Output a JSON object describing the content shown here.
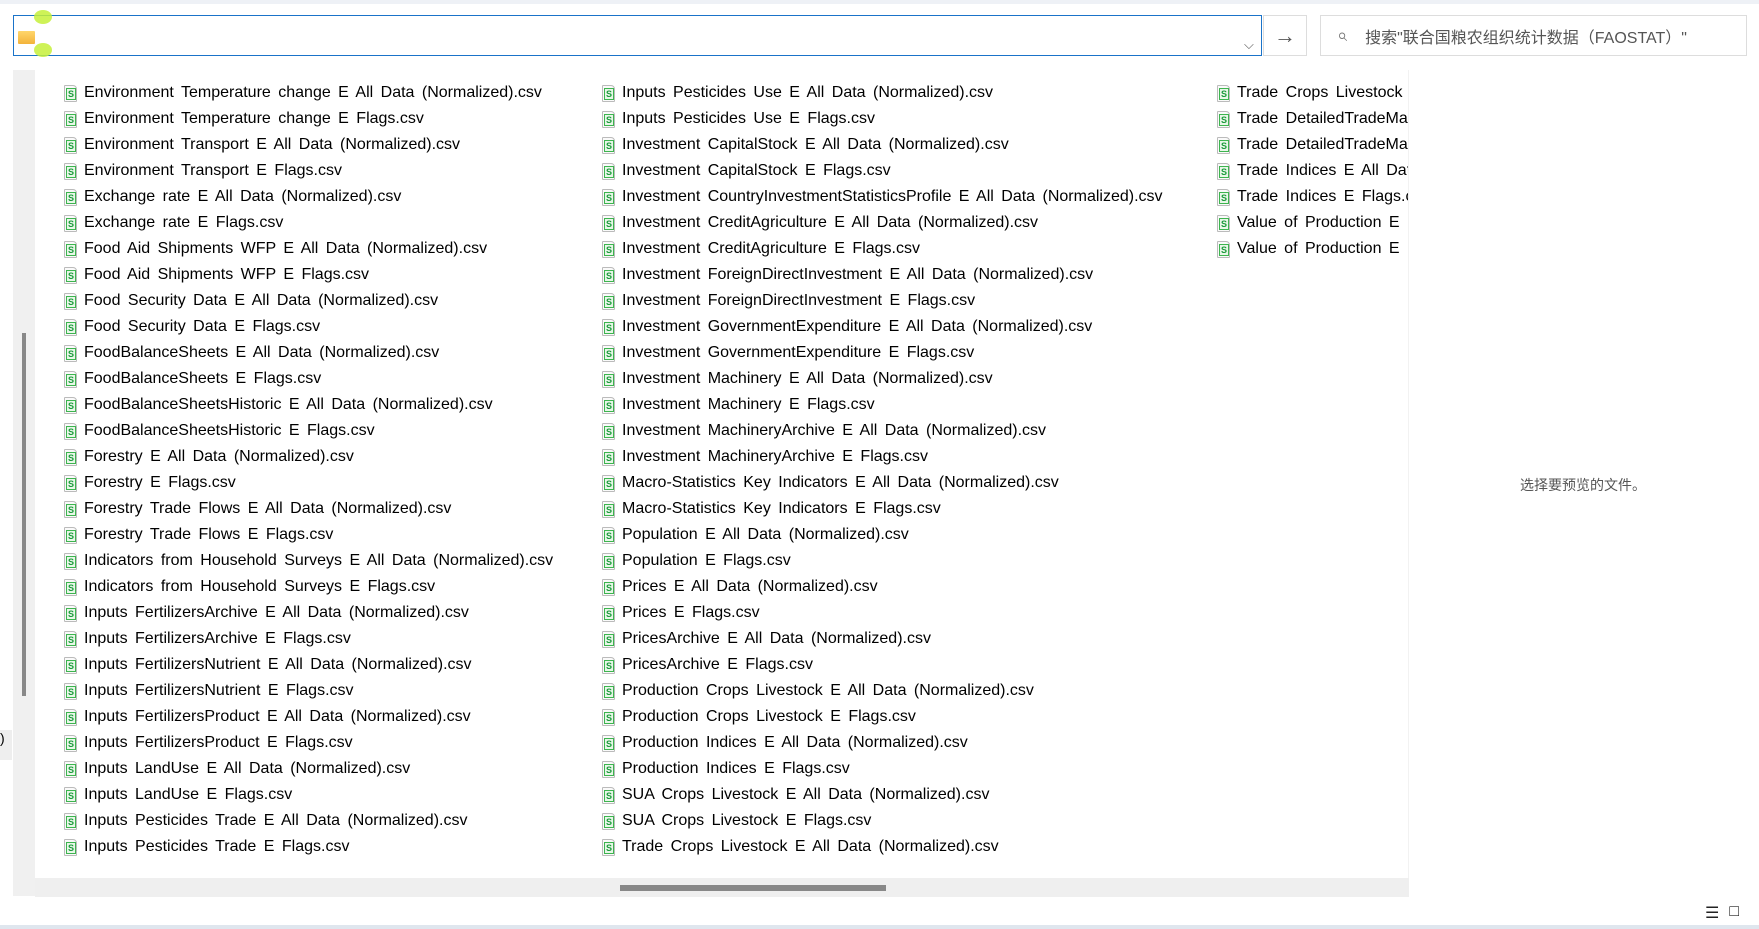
{
  "address_bar": {
    "value": ""
  },
  "search": {
    "placeholder": "搜索\"联合国粮农组织统计数据（FAOSTAT）\""
  },
  "preview_message": "选择要预览的文件。",
  "columns": [
    [
      "Environment Temperature change E All Data (Normalized).csv",
      "Environment Temperature change E Flags.csv",
      "Environment Transport E All Data (Normalized).csv",
      "Environment Transport E Flags.csv",
      "Exchange rate E All Data (Normalized).csv",
      "Exchange rate E Flags.csv",
      "Food Aid Shipments WFP E All Data (Normalized).csv",
      "Food Aid Shipments WFP E Flags.csv",
      "Food Security Data E All Data (Normalized).csv",
      "Food Security Data E Flags.csv",
      "FoodBalanceSheets E All Data (Normalized).csv",
      "FoodBalanceSheets E Flags.csv",
      "FoodBalanceSheetsHistoric E All Data (Normalized).csv",
      "FoodBalanceSheetsHistoric E Flags.csv",
      "Forestry E All Data (Normalized).csv",
      "Forestry E Flags.csv",
      "Forestry Trade Flows E All Data (Normalized).csv",
      "Forestry Trade Flows E Flags.csv",
      "Indicators from Household Surveys E All Data (Normalized).csv",
      "Indicators from Household Surveys E Flags.csv",
      "Inputs FertilizersArchive E All Data (Normalized).csv",
      "Inputs FertilizersArchive E Flags.csv",
      "Inputs FertilizersNutrient E All Data (Normalized).csv",
      "Inputs FertilizersNutrient E Flags.csv",
      "Inputs FertilizersProduct E All Data (Normalized).csv",
      "Inputs FertilizersProduct E Flags.csv",
      "Inputs LandUse E All Data (Normalized).csv",
      "Inputs LandUse E Flags.csv",
      "Inputs Pesticides Trade E All Data (Normalized).csv",
      "Inputs Pesticides Trade E Flags.csv"
    ],
    [
      "Inputs Pesticides Use E All Data (Normalized).csv",
      "Inputs Pesticides Use E Flags.csv",
      "Investment CapitalStock E All Data (Normalized).csv",
      "Investment CapitalStock E Flags.csv",
      "Investment CountryInvestmentStatisticsProfile E All Data (Normalized).csv",
      "Investment CreditAgriculture E All Data (Normalized).csv",
      "Investment CreditAgriculture E Flags.csv",
      "Investment ForeignDirectInvestment E All Data (Normalized).csv",
      "Investment ForeignDirectInvestment E Flags.csv",
      "Investment GovernmentExpenditure E All Data (Normalized).csv",
      "Investment GovernmentExpenditure E Flags.csv",
      "Investment Machinery E All Data (Normalized).csv",
      "Investment Machinery E Flags.csv",
      "Investment MachineryArchive E All Data (Normalized).csv",
      "Investment MachineryArchive E Flags.csv",
      "Macro-Statistics Key Indicators E All Data (Normalized).csv",
      "Macro-Statistics Key Indicators E Flags.csv",
      "Population E All Data (Normalized).csv",
      "Population E Flags.csv",
      "Prices E All Data (Normalized).csv",
      "Prices E Flags.csv",
      "PricesArchive E All Data (Normalized).csv",
      "PricesArchive E Flags.csv",
      "Production Crops Livestock E All Data (Normalized).csv",
      "Production Crops Livestock E Flags.csv",
      "Production Indices E All Data (Normalized).csv",
      "Production Indices E Flags.csv",
      "SUA Crops Livestock E All Data (Normalized).csv",
      "SUA Crops Livestock E Flags.csv",
      "Trade Crops Livestock E All Data (Normalized).csv"
    ],
    [
      "Trade Crops Livestock",
      "Trade DetailedTradeMa",
      "Trade DetailedTradeMa",
      "Trade Indices E All Dat",
      "Trade Indices E Flags.c",
      "Value of Production E",
      "Value of Production E"
    ]
  ]
}
